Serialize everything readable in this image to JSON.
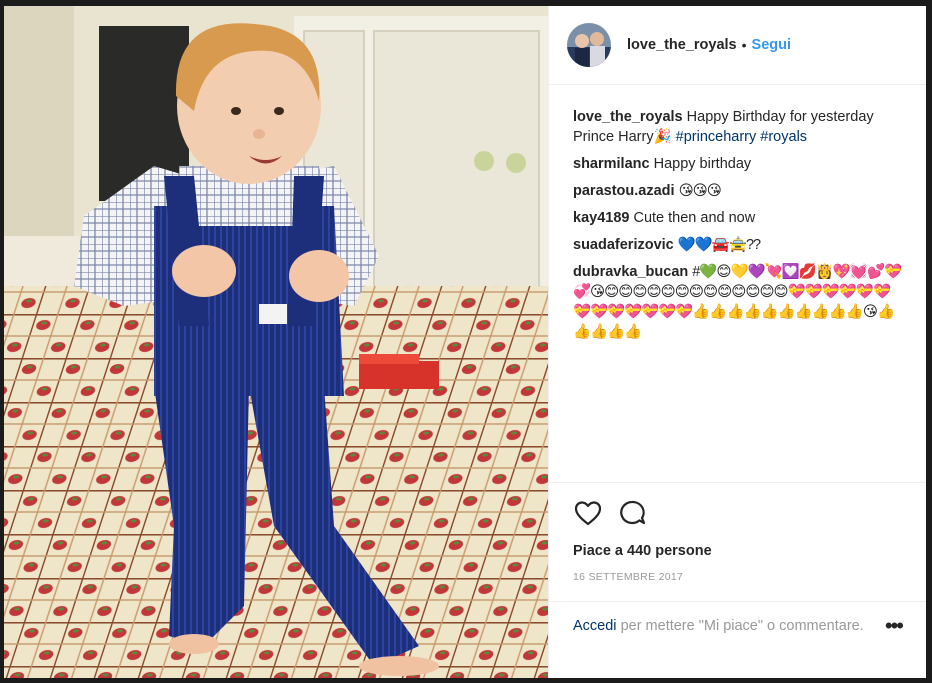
{
  "post": {
    "username": "love_the_royals",
    "separator": "•",
    "follow_label": "Segui"
  },
  "comments": [
    {
      "user": "love_the_royals",
      "text": "Happy Birthday for yesterday Prince Harry🎉",
      "tags": "#princeharry #royals"
    },
    {
      "user": "sharmilanc",
      "text": "Happy birthday"
    },
    {
      "user": "parastou.azadi",
      "text": "😘😘😘"
    },
    {
      "user": "kay4189",
      "text": "Cute then and now"
    },
    {
      "user": "suadaferizovic",
      "text": "💙💙🚘🚖??"
    },
    {
      "user": "dubravka_bucan",
      "text": "#💚😊💛💜💘💟💋👸💖💓💕💝💞😘😊😊😊😊😊😊😊😊😊😊😊😊😊💝💝💝💝💝💝💝💝💝💝💝💝💝👍👍👍👍👍👍👍👍👍👍😘👍👍👍👍👍"
    }
  ],
  "likes_text": "Piace a 440 persone",
  "date": "16 SETTEMBRE 2017",
  "login": {
    "link": "Accedi",
    "text": "per mettere \"Mi piace\" o commentare."
  },
  "more_label": "•••",
  "icons": {
    "like": "heart-icon",
    "comment": "comment-icon",
    "more": "more-options-icon"
  },
  "colors": {
    "link_blue": "#3897f0",
    "hashtag": "#003569",
    "text": "#262626",
    "muted": "#999999"
  }
}
